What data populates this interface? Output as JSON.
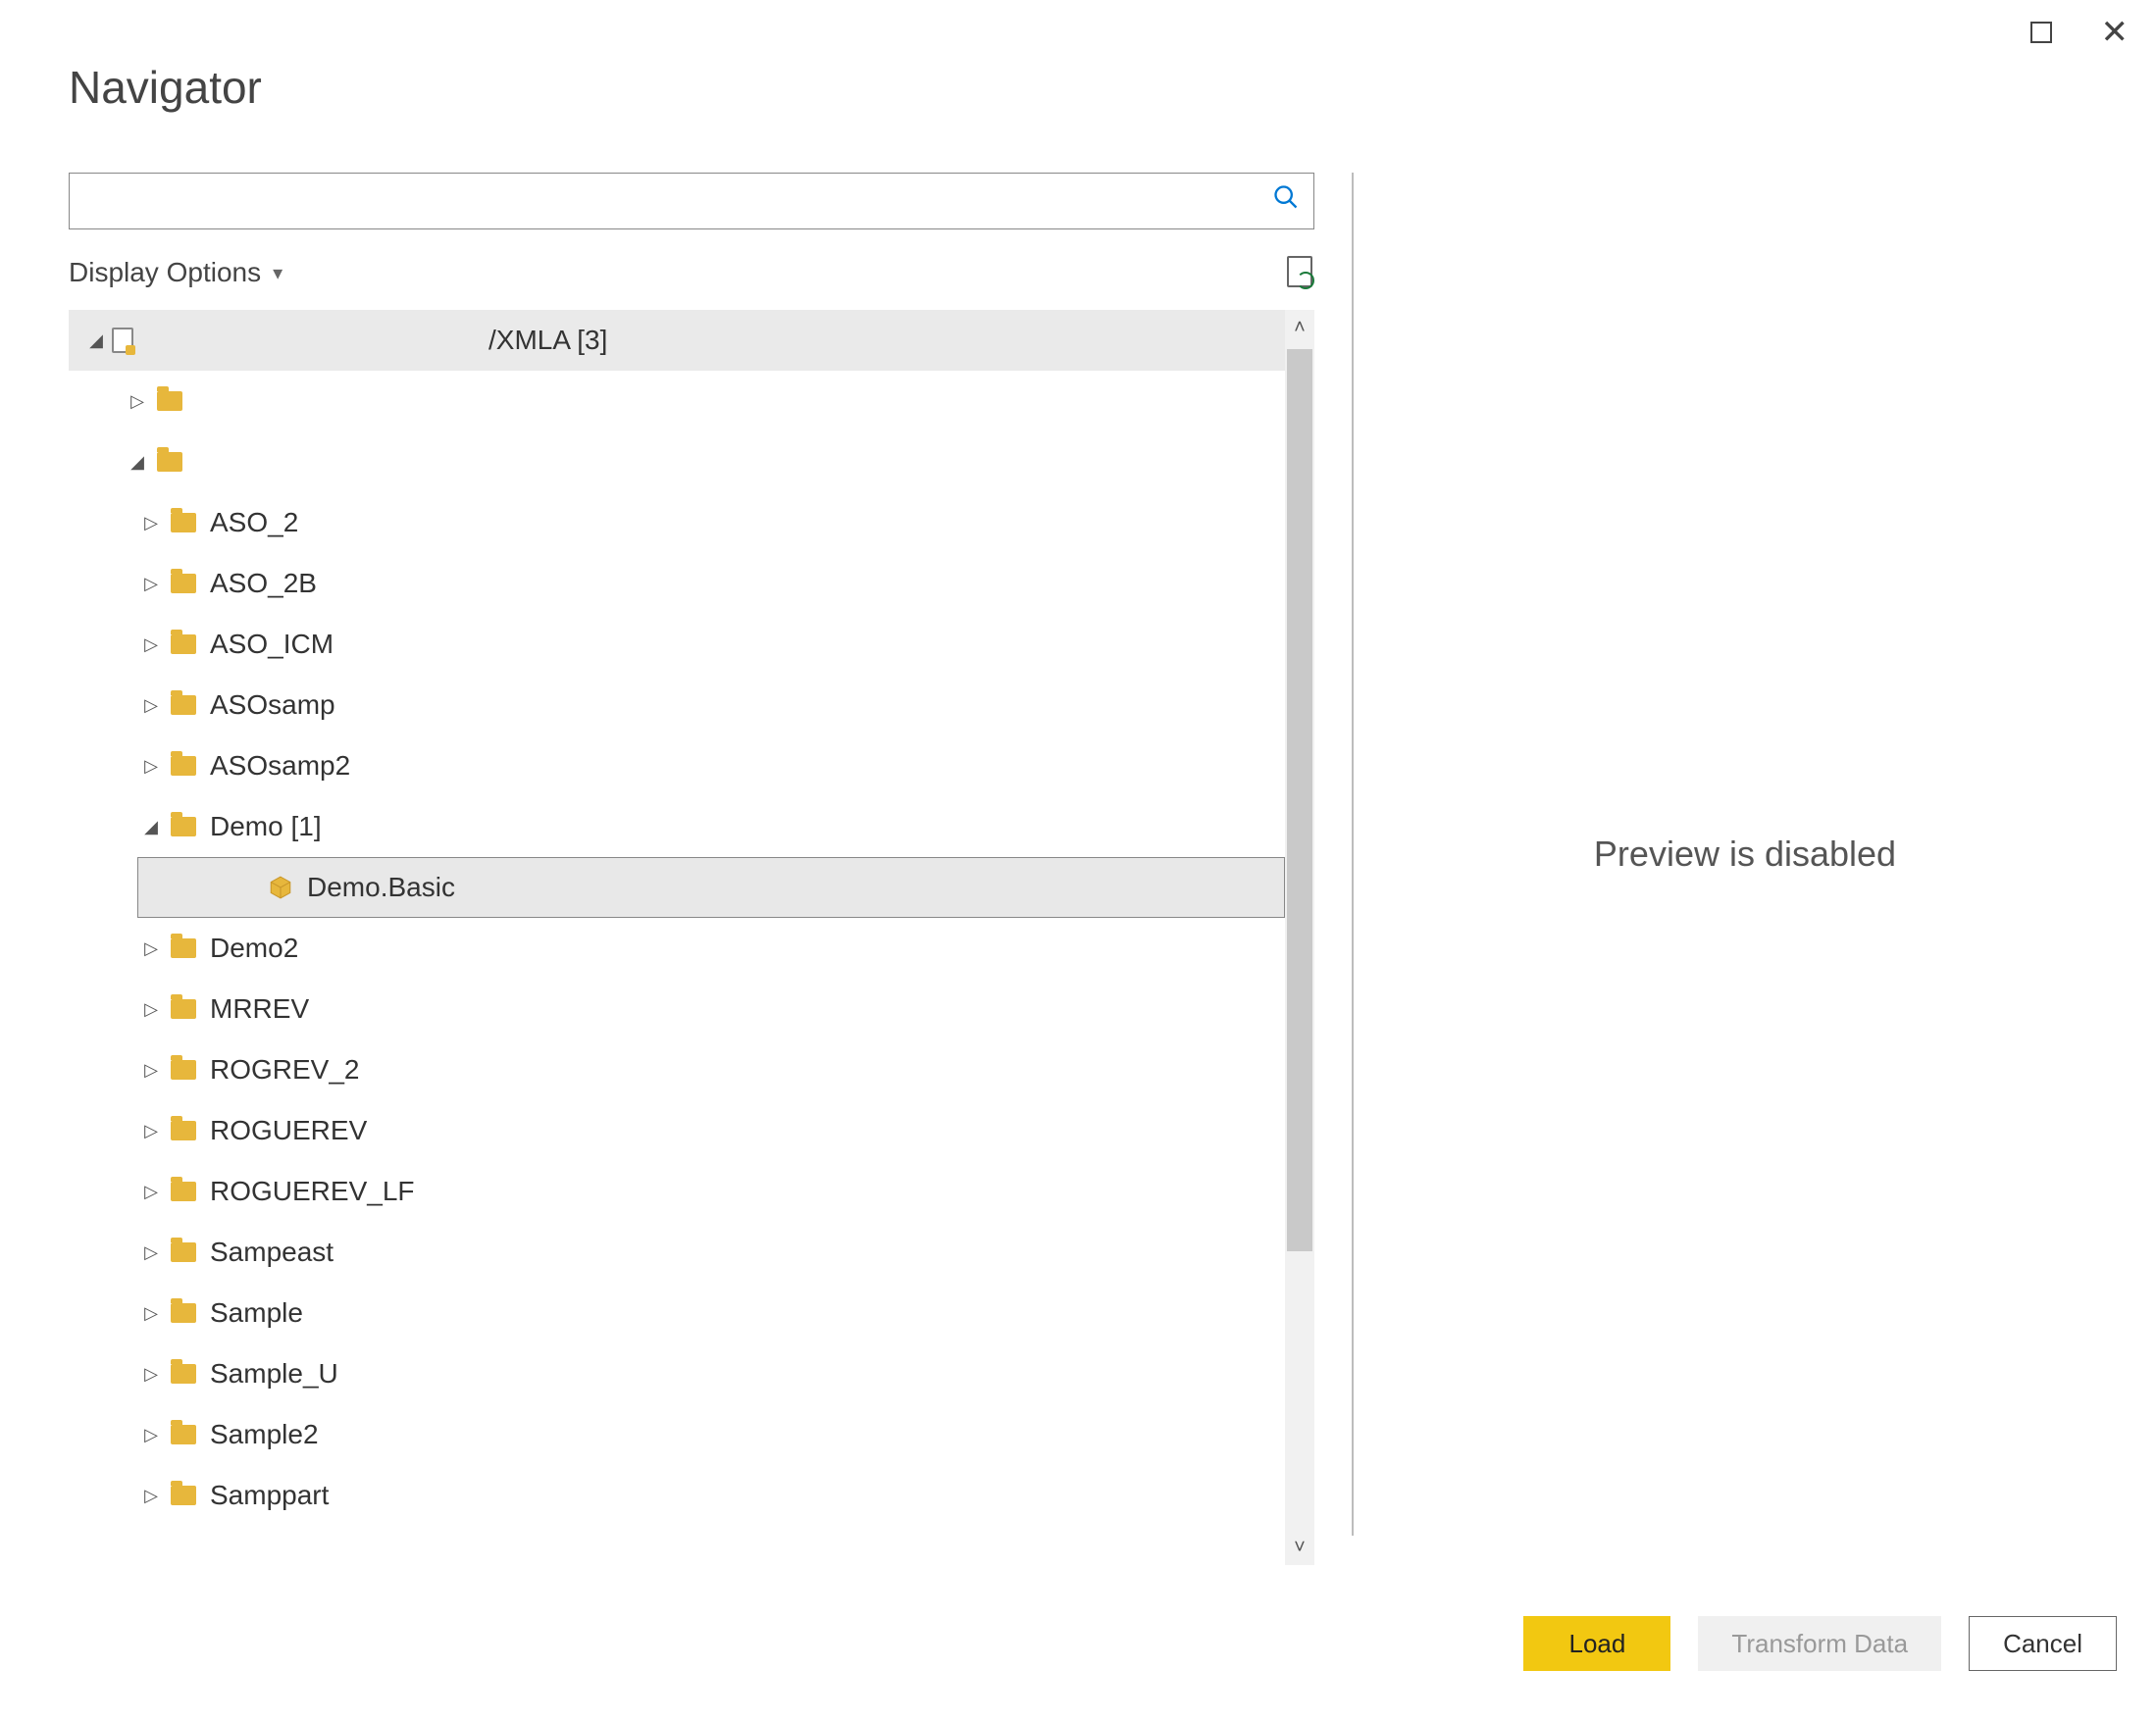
{
  "window": {
    "title": "Navigator"
  },
  "search": {
    "value": "",
    "placeholder": ""
  },
  "options": {
    "label": "Display Options"
  },
  "tree": {
    "root_label": "/XMLA [3]",
    "items": [
      {
        "label": "",
        "indent": "pad-2",
        "toggle": "▷",
        "icon": "folder"
      },
      {
        "label": "",
        "indent": "pad-2",
        "toggle": "◢",
        "icon": "folder"
      },
      {
        "label": "ASO_2",
        "indent": "pad-3",
        "toggle": "▷",
        "icon": "folder"
      },
      {
        "label": "ASO_2B",
        "indent": "pad-3",
        "toggle": "▷",
        "icon": "folder"
      },
      {
        "label": "ASO_ICM",
        "indent": "pad-3",
        "toggle": "▷",
        "icon": "folder"
      },
      {
        "label": "ASOsamp",
        "indent": "pad-3",
        "toggle": "▷",
        "icon": "folder"
      },
      {
        "label": "ASOsamp2",
        "indent": "pad-3",
        "toggle": "▷",
        "icon": "folder"
      },
      {
        "label": "Demo [1]",
        "indent": "pad-3",
        "toggle": "◢",
        "icon": "folder"
      },
      {
        "label": "Demo.Basic",
        "indent": "pad-4",
        "toggle": "",
        "icon": "cube",
        "selected": true
      },
      {
        "label": "Demo2",
        "indent": "pad-3",
        "toggle": "▷",
        "icon": "folder"
      },
      {
        "label": "MRREV",
        "indent": "pad-3",
        "toggle": "▷",
        "icon": "folder"
      },
      {
        "label": "ROGREV_2",
        "indent": "pad-3",
        "toggle": "▷",
        "icon": "folder"
      },
      {
        "label": "ROGUEREV",
        "indent": "pad-3",
        "toggle": "▷",
        "icon": "folder"
      },
      {
        "label": "ROGUEREV_LF",
        "indent": "pad-3",
        "toggle": "▷",
        "icon": "folder"
      },
      {
        "label": "Sampeast",
        "indent": "pad-3",
        "toggle": "▷",
        "icon": "folder"
      },
      {
        "label": "Sample",
        "indent": "pad-3",
        "toggle": "▷",
        "icon": "folder"
      },
      {
        "label": "Sample_U",
        "indent": "pad-3",
        "toggle": "▷",
        "icon": "folder"
      },
      {
        "label": "Sample2",
        "indent": "pad-3",
        "toggle": "▷",
        "icon": "folder"
      },
      {
        "label": "Samppart",
        "indent": "pad-3",
        "toggle": "▷",
        "icon": "folder"
      }
    ]
  },
  "preview": {
    "message": "Preview is disabled"
  },
  "footer": {
    "load": "Load",
    "transform": "Transform Data",
    "cancel": "Cancel"
  }
}
